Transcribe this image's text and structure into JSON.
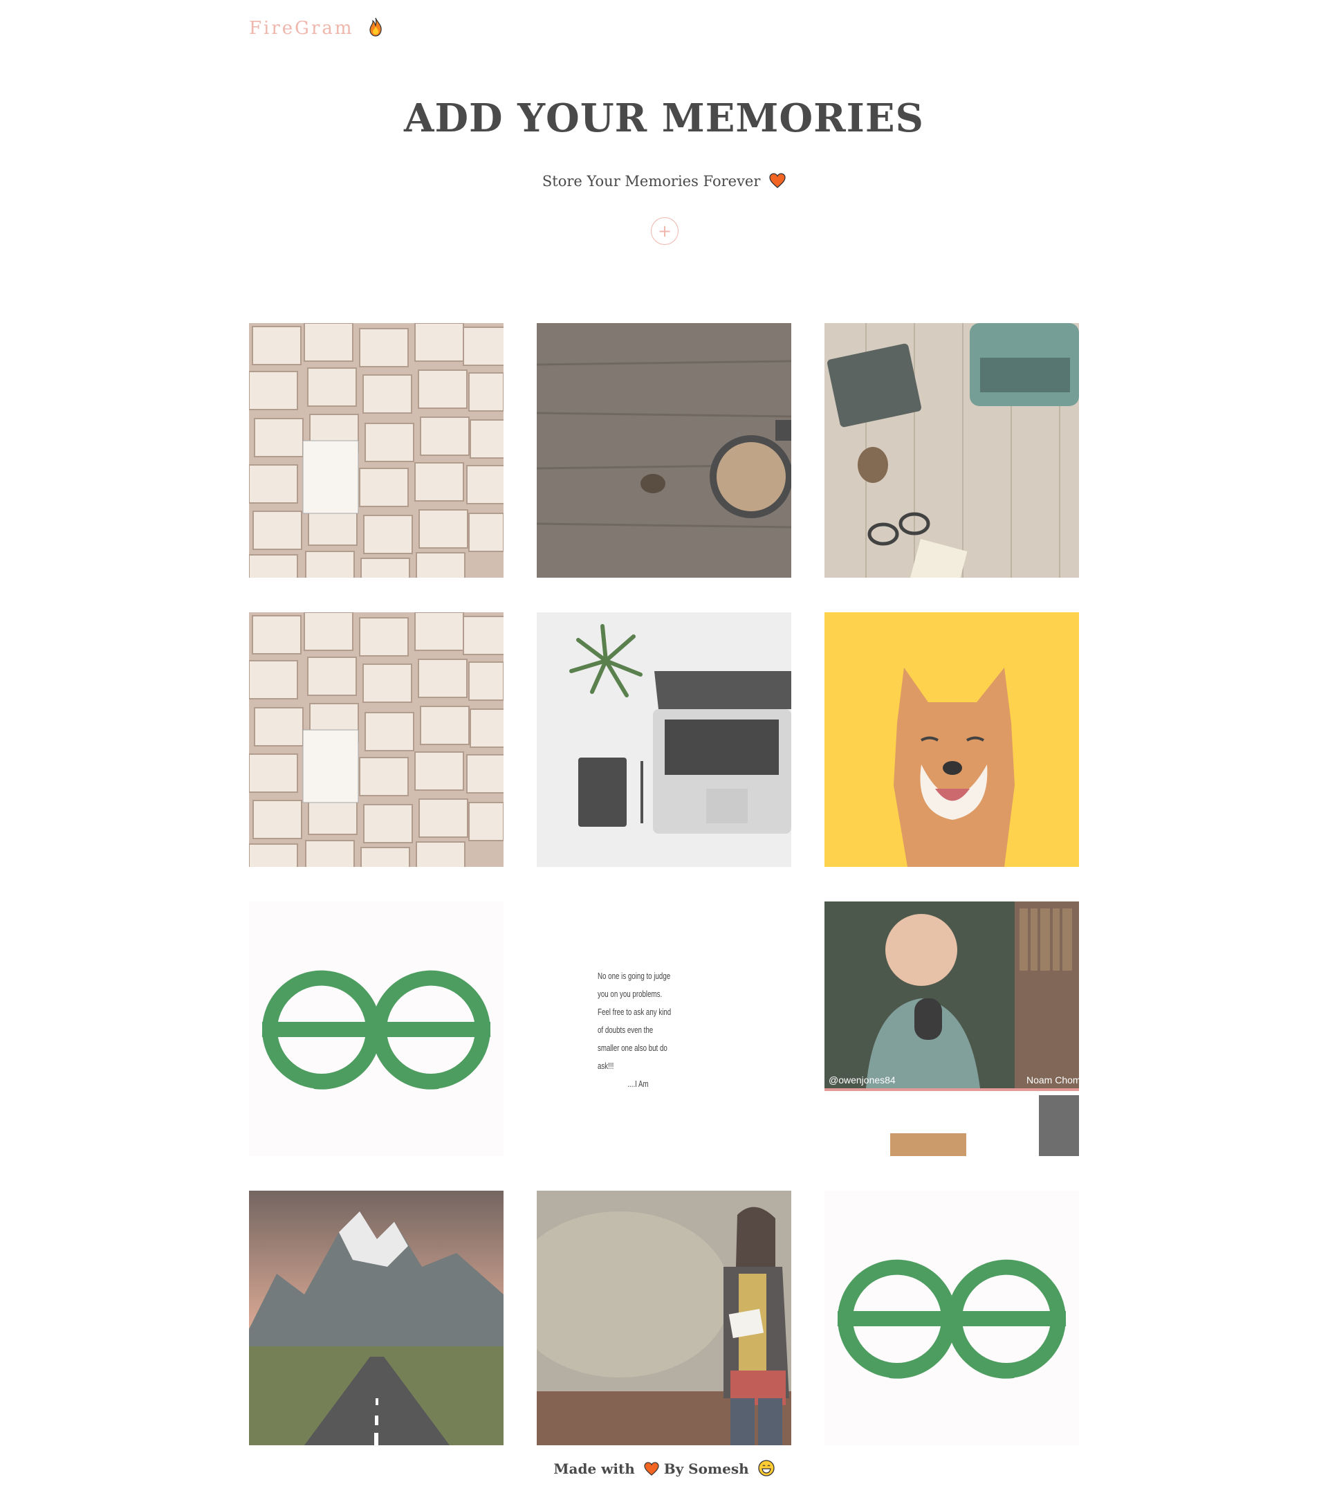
{
  "header": {
    "logo_text": "FireGram",
    "logo_icon": "fire-icon"
  },
  "hero": {
    "title": "ADD YOUR MEMORIES",
    "subtitle": "Store Your Memories Forever",
    "subtitle_icon": "heart-icon",
    "upload_button_label": "+"
  },
  "gallery": {
    "images": [
      {
        "subject": "open books"
      },
      {
        "subject": "coffee mug on wood"
      },
      {
        "subject": "typewriter and notebook"
      },
      {
        "subject": "open books"
      },
      {
        "subject": "laptop and plant"
      },
      {
        "subject": "shiba inu dog"
      },
      {
        "subject": "GfG logo"
      },
      {
        "subject": "handwritten note",
        "text": "No one is going to judge\nyou on you problems.\nFeel free to ask any kind\nof doubts even the\nsmaller one also but do\nask!!!\n                ....I Am"
      },
      {
        "subject": "video call screenshot",
        "caption_left": "@owenjones84",
        "caption_right": "Noam Chom"
      },
      {
        "subject": "mountain road"
      },
      {
        "subject": "woman reading letter"
      },
      {
        "subject": "GfG logo"
      }
    ]
  },
  "footer": {
    "made_with": "Made with",
    "by": "By Somesh",
    "heart_icon": "heart-icon",
    "emoji_icon": "grinning-face-icon"
  },
  "colors": {
    "accent": "#efb6ac",
    "text": "#4a4a4a",
    "gfg_green": "#2f8d46"
  }
}
